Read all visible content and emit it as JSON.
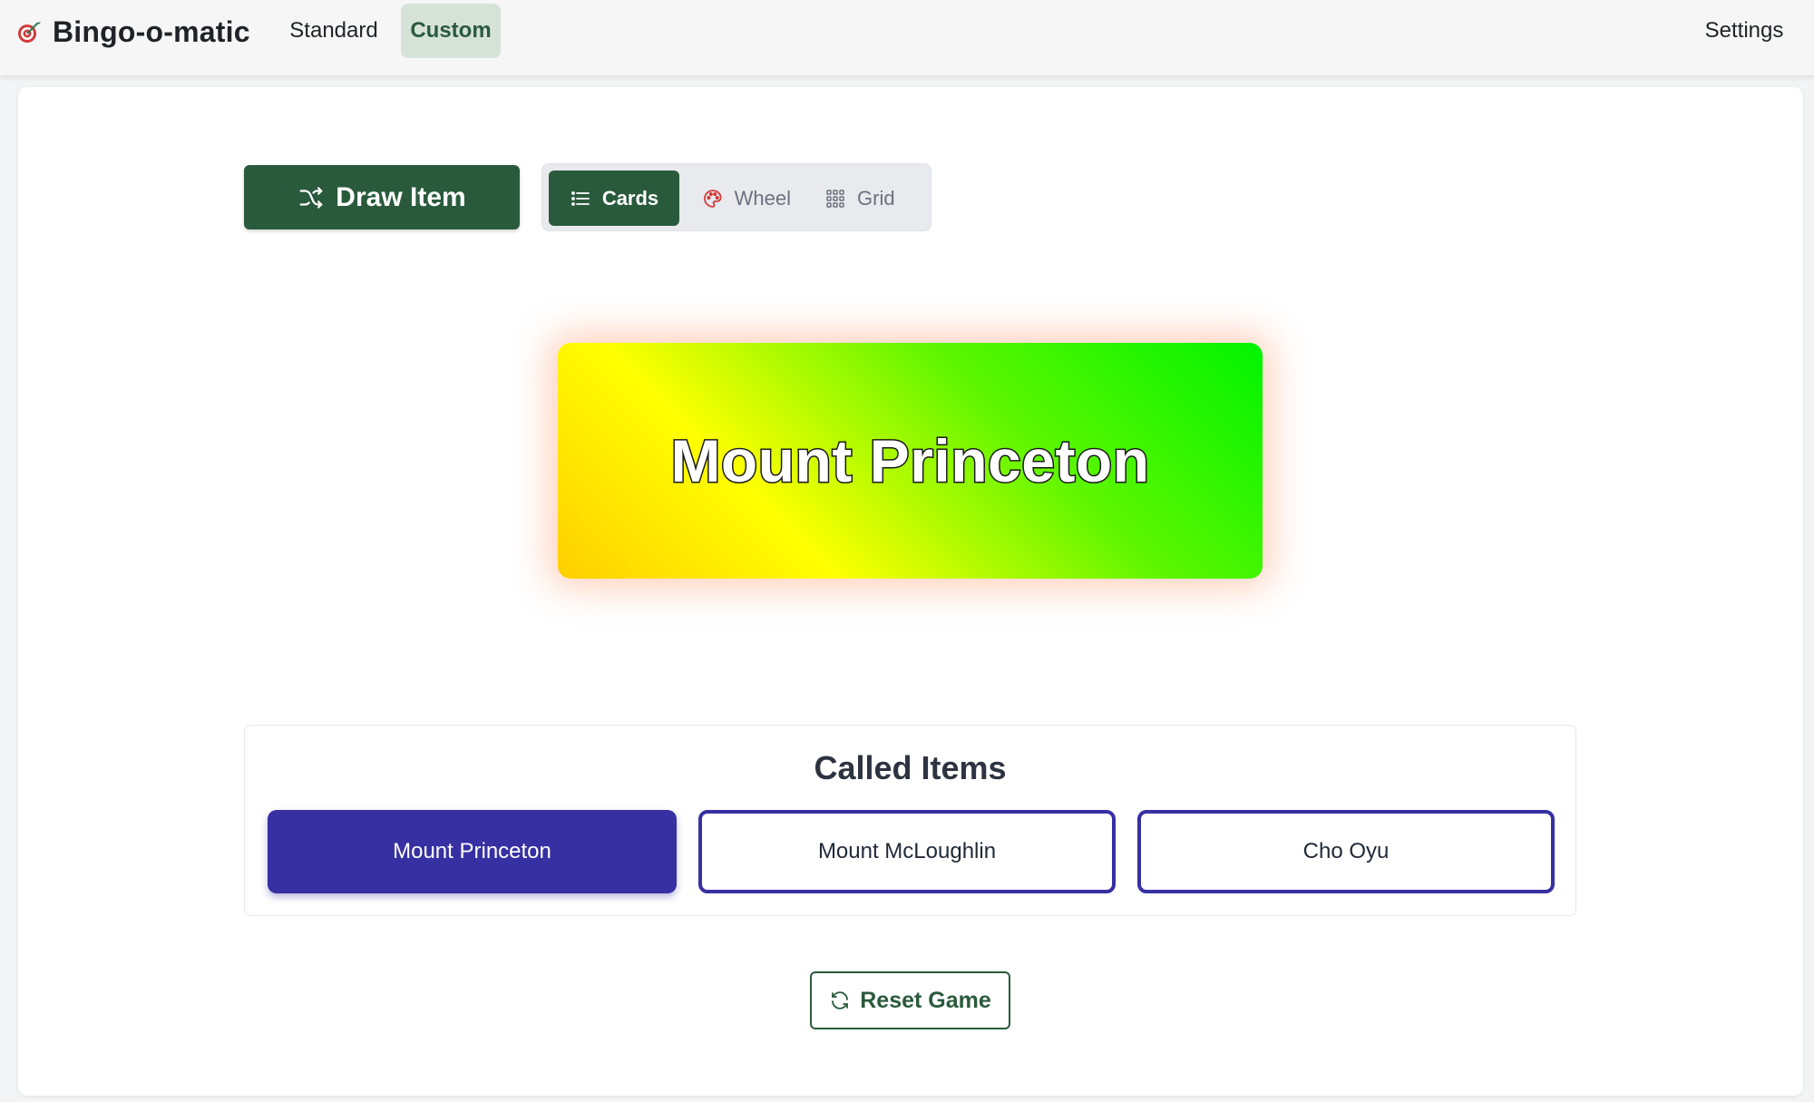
{
  "app": {
    "name": "Bingo-o-matic",
    "logo_icon": "target-icon"
  },
  "nav": {
    "items": [
      {
        "label": "Standard",
        "active": false
      },
      {
        "label": "Custom",
        "active": true
      }
    ],
    "settings_label": "Settings"
  },
  "toolbar": {
    "draw_label": "Draw Item",
    "draw_icon": "shuffle-icon",
    "views": [
      {
        "label": "Cards",
        "icon": "list-icon",
        "active": true
      },
      {
        "label": "Wheel",
        "icon": "palette-icon",
        "active": false
      },
      {
        "label": "Grid",
        "icon": "grid-icon",
        "active": false
      }
    ]
  },
  "current_item": {
    "label": "Mount Princeton"
  },
  "called": {
    "title": "Called Items",
    "items": [
      {
        "label": "Mount Princeton",
        "highlighted": true
      },
      {
        "label": "Mount McLoughlin",
        "highlighted": false
      },
      {
        "label": "Cho Oyu",
        "highlighted": false
      }
    ]
  },
  "reset": {
    "label": "Reset Game",
    "icon": "refresh-icon"
  },
  "colors": {
    "primary_green": "#2a5a3c",
    "called_indigo": "#3730a3",
    "card_gradient": [
      "#00f400",
      "#ffff00",
      "#ffcf00"
    ]
  }
}
